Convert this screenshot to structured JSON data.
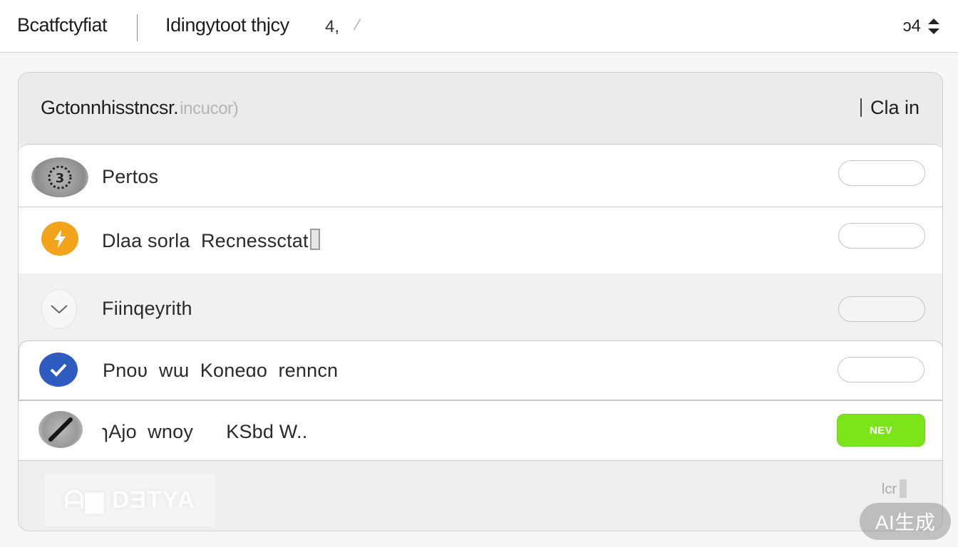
{
  "header": {
    "app_title": "Bcatfctyfiat",
    "subtitle": "Idingytoot thjcy",
    "count": "4,",
    "mark": "⁄",
    "right_text": "ɔ4"
  },
  "panel": {
    "title": "Gctonnhisstncsr.",
    "title_hint": "incucor)",
    "action": "Cla in"
  },
  "rows": [
    {
      "label": "Pertos",
      "icon": "gear-icon",
      "icon_color": "#8a8a8a"
    },
    {
      "label": "Dlaa sorla  Recnessctat",
      "icon": "bolt-icon",
      "icon_color": "#f3a41a"
    },
    {
      "label": "Fiinqeyrith",
      "icon": "chevron-down-icon",
      "icon_color": "#f2f2f2"
    },
    {
      "label": "Pnoʋ  wɯ  Koneɑo  renncn",
      "icon": "check-icon",
      "icon_color": "#2e5bbf"
    },
    {
      "label": "ɿAjo  wnoy      KSbd W..",
      "icon": "slash-icon",
      "icon_color": "#6a6a6a",
      "badge": "NEV"
    }
  ],
  "footer": {
    "button_text": "ᗩ▆ DƎTYA",
    "mark": "lcr"
  },
  "watermark": "AI生成"
}
